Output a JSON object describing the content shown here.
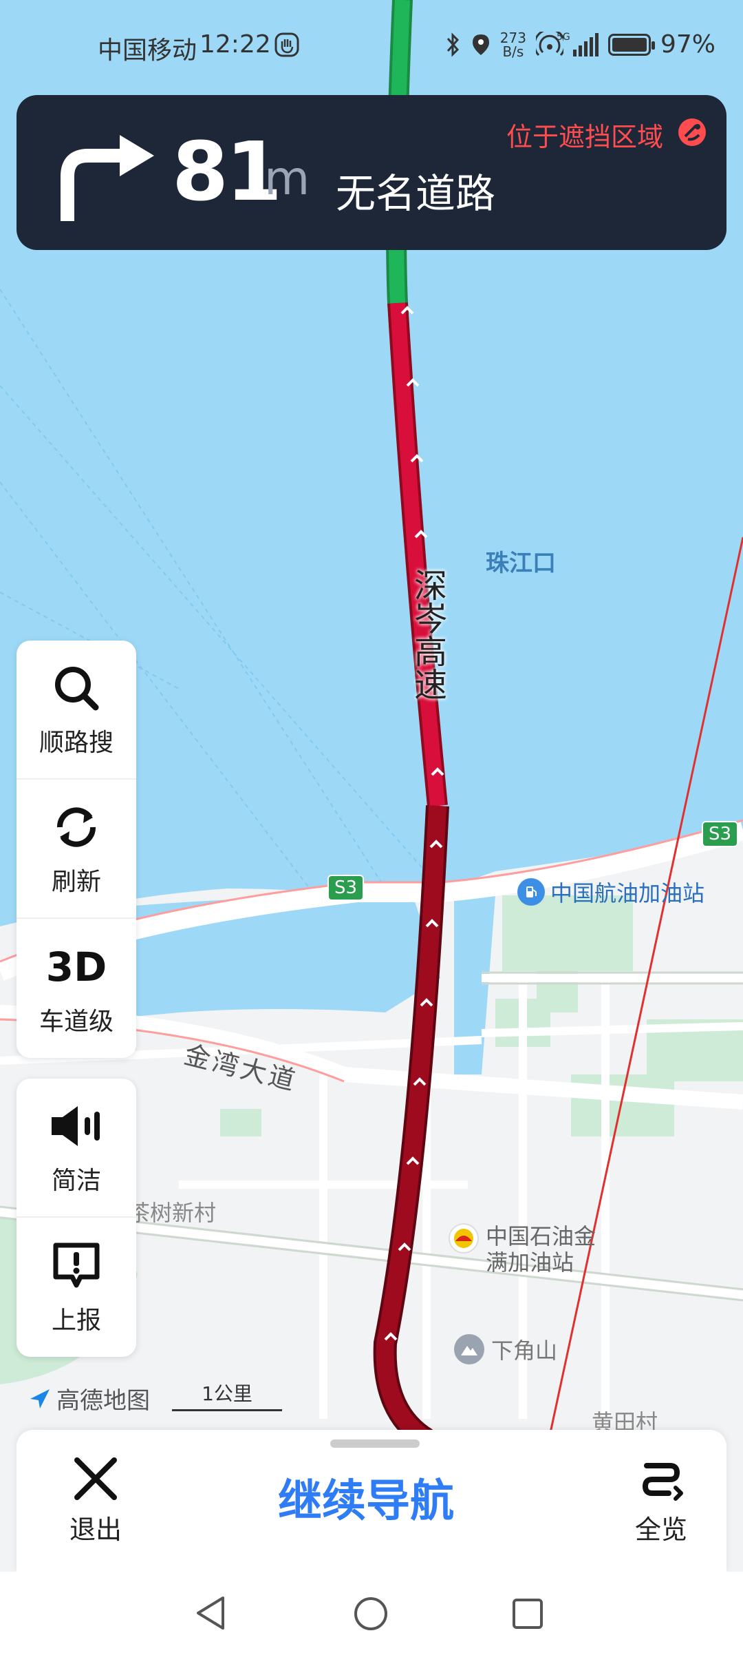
{
  "status_bar": {
    "carrier": "中国移动",
    "time": "12:22",
    "net_speed_value": "273",
    "net_speed_unit": "B/s",
    "network": "5G",
    "battery": "97%"
  },
  "nav_card": {
    "distance": "81",
    "unit": "m",
    "road_name": "无名道路",
    "warning": "位于遮挡区域"
  },
  "map": {
    "labels": {
      "highway": "深岑高速",
      "water": "珠江口",
      "avenue": "金湾大道",
      "gas_station_1": "中国航油加油站",
      "gas_station_2_line1": "中国石油金",
      "gas_station_2_line2": "满加油站",
      "mountain": "下角山",
      "village_1": "茶树新村",
      "village_2": "黄田村",
      "shield_1": "S3",
      "shield_2": "S3"
    },
    "logo": "高德地图",
    "scale": "1公里"
  },
  "tools_panel_1": [
    {
      "label": "顺路搜",
      "icon": "search-icon"
    },
    {
      "label": "刷新",
      "icon": "refresh-icon"
    },
    {
      "label": "车道级",
      "icon_text": "3D"
    }
  ],
  "tools_panel_2": [
    {
      "label": "简洁",
      "icon": "speaker-icon"
    },
    {
      "label": "上报",
      "icon": "report-icon"
    }
  ],
  "bottom": {
    "exit_label": "退出",
    "continue_label": "继续导航",
    "overview_label": "全览"
  },
  "colors": {
    "accent": "#2e7cf6",
    "nav_bg": "#1d2738",
    "route_congested": "#d90f3b",
    "route_heavy": "#9e0b1e",
    "route_clear": "#1fb65a",
    "water": "#9dd9f7"
  }
}
